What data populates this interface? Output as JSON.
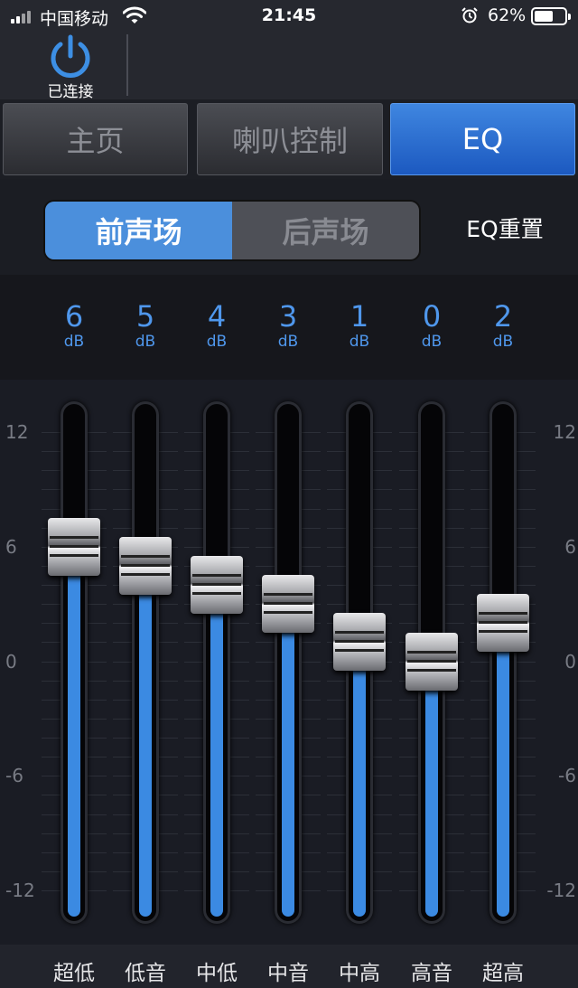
{
  "status_bar": {
    "carrier": "中国移动",
    "time": "21:45",
    "battery": "62%",
    "battery_level": 0.62,
    "icons": [
      "signal-icon",
      "wifi-icon",
      "alarm-icon",
      "battery-icon"
    ]
  },
  "connection": {
    "icon": "power-icon",
    "label": "已连接",
    "accent": "#3d8fe4"
  },
  "tabs": [
    {
      "label": "主页",
      "active": false
    },
    {
      "label": "喇叭控制",
      "active": false
    },
    {
      "label": "EQ",
      "active": true
    }
  ],
  "sound_field": {
    "options": [
      {
        "label": "前声场",
        "active": true
      },
      {
        "label": "后声场",
        "active": false
      }
    ],
    "reset_label": "EQ重置"
  },
  "eq": {
    "unit": "dB",
    "min": -12,
    "max": 12,
    "scale_labels": [
      "12",
      "6",
      "0",
      "-6",
      "-12"
    ],
    "scale_values": [
      12,
      6,
      0,
      -6,
      -12
    ],
    "fill_color": "#3b8ae2",
    "bands": [
      {
        "label": "超低",
        "value": 6
      },
      {
        "label": "低音",
        "value": 5
      },
      {
        "label": "中低",
        "value": 4
      },
      {
        "label": "中音",
        "value": 3
      },
      {
        "label": "中高",
        "value": 1
      },
      {
        "label": "高音",
        "value": 0
      },
      {
        "label": "超高",
        "value": 2
      }
    ]
  }
}
